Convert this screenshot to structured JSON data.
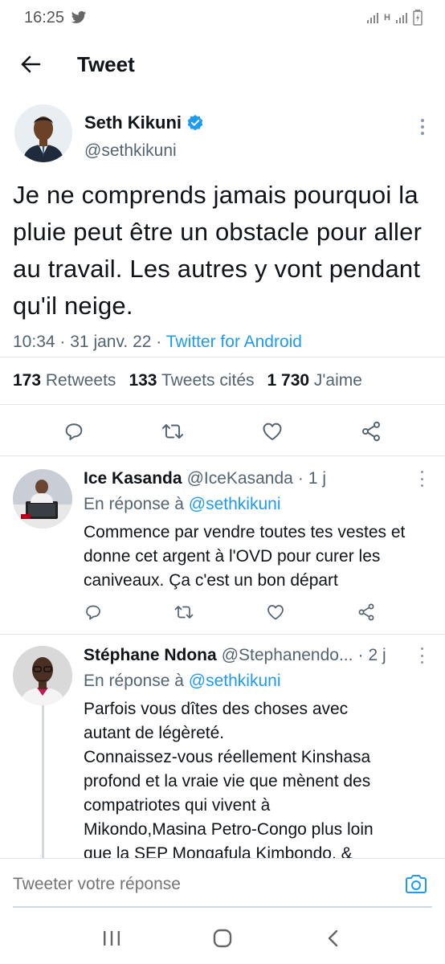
{
  "status_bar": {
    "time": "16:25",
    "network_h": "H"
  },
  "header": {
    "title": "Tweet"
  },
  "main_tweet": {
    "author_name": "Seth Kikuni",
    "author_handle": "@sethkikuni",
    "text": "Je ne comprends jamais pourquoi la pluie peut être un obstacle pour aller au travail. Les autres y vont pendant qu'il neige.",
    "time": "10:34",
    "date": "31 janv. 22",
    "separator": "·",
    "source": "Twitter for Android",
    "stats": {
      "retweets_count": "173",
      "retweets_label": "Retweets",
      "quotes_count": "133",
      "quotes_label": "Tweets cités",
      "likes_count": "1 730",
      "likes_label": "J'aime"
    }
  },
  "replies": [
    {
      "name": "Ice Kasanda",
      "handle": "@IceKasanda",
      "age": "1 j",
      "replying_prefix": "En réponse à",
      "replying_to": "@sethkikuni",
      "text": "Commence par vendre toutes tes vestes et donne cet argent à l'OVD pour curer les caniveaux. Ça c'est un bon départ"
    },
    {
      "name": "Stéphane Ndona",
      "handle": "@Stephanendo...",
      "age": "2 j",
      "replying_prefix": "En réponse à",
      "replying_to": "@sethkikuni",
      "text_lines": [
        "Parfois vous dîtes des choses avec",
        "autant de légèreté.",
        "Connaissez-vous réellement Kinshasa",
        "profond et la vraie vie que mènent des",
        "compatriotes qui vivent à",
        "Mikondo,Masina Petro-Congo plus loin",
        "que la SEP Mongafula Kimbondo, &"
      ]
    }
  ],
  "composer": {
    "placeholder": "Tweeter votre réponse"
  },
  "colors": {
    "accent": "#1d9bf0",
    "text": "#0f1419",
    "secondary": "#536471",
    "divider": "#e3e7ea"
  }
}
